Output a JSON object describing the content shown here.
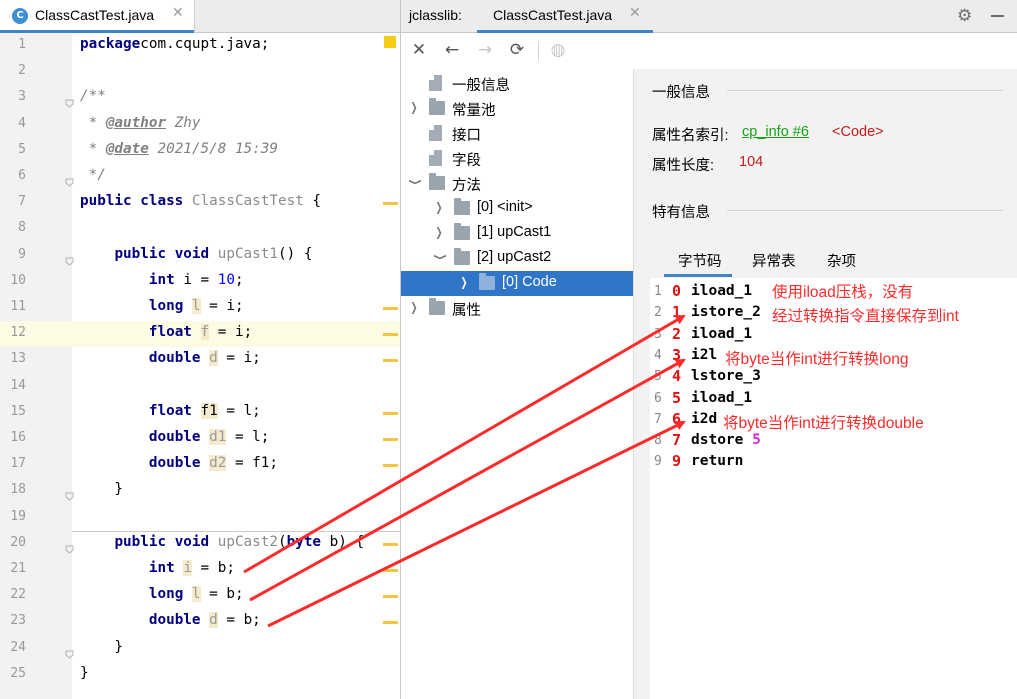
{
  "editor": {
    "tab": {
      "icon_letter": "C",
      "label": "ClassCastTest.java",
      "close": "✕"
    },
    "lines": [
      {
        "n": "1",
        "tokens": [
          [
            "kw",
            "package"
          ],
          [
            "",
            "com.cqupt.java;"
          ]
        ]
      },
      {
        "n": "2",
        "tokens": []
      },
      {
        "n": "3",
        "tokens": [
          [
            "cm",
            "/**"
          ]
        ]
      },
      {
        "n": "4",
        "tokens": [
          [
            "cm",
            " * "
          ],
          [
            "tag",
            "@author"
          ],
          [
            "cm",
            " Zhy"
          ]
        ]
      },
      {
        "n": "5",
        "tokens": [
          [
            "cm",
            " * "
          ],
          [
            "tag",
            "@date"
          ],
          [
            "cm",
            " 2021/5/8 15:39"
          ]
        ]
      },
      {
        "n": "6",
        "tokens": [
          [
            "cm",
            " */"
          ]
        ]
      },
      {
        "n": "7",
        "tokens": [
          [
            "kw",
            "public class "
          ],
          [
            "grey",
            "ClassCastTest"
          ],
          [
            "",
            " {"
          ]
        ]
      },
      {
        "n": "8",
        "tokens": []
      },
      {
        "n": "9",
        "tokens": [
          [
            "",
            "    "
          ],
          [
            "kw",
            "public void "
          ],
          [
            "grey",
            "upCast1"
          ],
          [
            "",
            "() {"
          ]
        ]
      },
      {
        "n": "10",
        "tokens": [
          [
            "",
            "        "
          ],
          [
            "kw",
            "int "
          ],
          [
            "",
            "i = "
          ],
          [
            "num",
            "10"
          ],
          [
            "",
            ";"
          ]
        ]
      },
      {
        "n": "11",
        "tokens": [
          [
            "",
            "        "
          ],
          [
            "kw",
            "long "
          ],
          [
            "unused",
            "l"
          ],
          [
            "",
            " = i;"
          ]
        ]
      },
      {
        "n": "12",
        "tokens": [
          [
            "",
            "        "
          ],
          [
            "kw",
            "float "
          ],
          [
            "unused",
            "f"
          ],
          [
            "",
            " = i;"
          ]
        ]
      },
      {
        "n": "13",
        "tokens": [
          [
            "",
            "        "
          ],
          [
            "kw",
            "double "
          ],
          [
            "unused",
            "d"
          ],
          [
            "",
            " = i;"
          ]
        ]
      },
      {
        "n": "14",
        "tokens": []
      },
      {
        "n": "15",
        "tokens": [
          [
            "",
            "        "
          ],
          [
            "kw",
            "float "
          ],
          [
            "vhl",
            "f1"
          ],
          [
            "",
            " = l;"
          ]
        ]
      },
      {
        "n": "16",
        "tokens": [
          [
            "",
            "        "
          ],
          [
            "kw",
            "double "
          ],
          [
            "unused",
            "d1"
          ],
          [
            "",
            " = l;"
          ]
        ]
      },
      {
        "n": "17",
        "tokens": [
          [
            "",
            "        "
          ],
          [
            "kw",
            "double "
          ],
          [
            "unused",
            "d2"
          ],
          [
            "",
            " = f1;"
          ]
        ]
      },
      {
        "n": "18",
        "tokens": [
          [
            "",
            "    }"
          ]
        ]
      },
      {
        "n": "19",
        "tokens": []
      },
      {
        "n": "20",
        "tokens": [
          [
            "",
            "    "
          ],
          [
            "kw",
            "public void "
          ],
          [
            "grey",
            "upCast2"
          ],
          [
            "",
            "("
          ],
          [
            "kw",
            "byte "
          ],
          [
            "",
            "b) {"
          ]
        ]
      },
      {
        "n": "21",
        "tokens": [
          [
            "",
            "        "
          ],
          [
            "kw",
            "int "
          ],
          [
            "unused",
            "i"
          ],
          [
            "",
            " = b;"
          ]
        ]
      },
      {
        "n": "22",
        "tokens": [
          [
            "",
            "        "
          ],
          [
            "kw",
            "long "
          ],
          [
            "unused",
            "l"
          ],
          [
            "",
            " = b;"
          ]
        ]
      },
      {
        "n": "23",
        "tokens": [
          [
            "",
            "        "
          ],
          [
            "kw",
            "double "
          ],
          [
            "unused",
            "d"
          ],
          [
            "",
            " = b;"
          ]
        ]
      },
      {
        "n": "24",
        "tokens": [
          [
            "",
            "    }"
          ]
        ]
      },
      {
        "n": "25",
        "tokens": [
          [
            "",
            "}"
          ]
        ]
      }
    ]
  },
  "jclasslib": {
    "title": "jclasslib:",
    "tab_label": "ClassCastTest.java",
    "tab_close": "✕",
    "toolbar": {
      "close": "✕",
      "back": "←",
      "forward": "→",
      "refresh": "⟳",
      "web": "◍"
    },
    "tree": [
      {
        "label": "一般信息",
        "indent": 0,
        "arrow": "",
        "icon": "page",
        "selected": false
      },
      {
        "label": "常量池",
        "indent": 0,
        "arrow": "›",
        "icon": "folder",
        "selected": false
      },
      {
        "label": "接口",
        "indent": 0,
        "arrow": "",
        "icon": "page",
        "selected": false
      },
      {
        "label": "字段",
        "indent": 0,
        "arrow": "",
        "icon": "page",
        "selected": false
      },
      {
        "label": "方法",
        "indent": 0,
        "arrow": "⌄",
        "icon": "folder",
        "selected": false
      },
      {
        "label": "[0] <init>",
        "indent": 1,
        "arrow": "›",
        "icon": "folder",
        "selected": false
      },
      {
        "label": "[1] upCast1",
        "indent": 1,
        "arrow": "›",
        "icon": "folder",
        "selected": false
      },
      {
        "label": "[2] upCast2",
        "indent": 1,
        "arrow": "⌄",
        "icon": "folder",
        "selected": false
      },
      {
        "label": "[0] Code",
        "indent": 2,
        "arrow": "›",
        "icon": "folder",
        "selected": true
      },
      {
        "label": "属性",
        "indent": 0,
        "arrow": "›",
        "icon": "folder",
        "selected": false
      }
    ],
    "detail": {
      "general_title": "一般信息",
      "attr_name_label": "属性名索引:",
      "attr_name_link": "cp_info #6",
      "attr_name_value": "<Code>",
      "attr_len_label": "属性长度:",
      "attr_len_value": "104",
      "specific_title": "特有信息",
      "subtabs": [
        "字节码",
        "异常表",
        "杂项"
      ],
      "bytecode": [
        {
          "n": "1",
          "off": "0",
          "op": "iload_1",
          "arg": ""
        },
        {
          "n": "2",
          "off": "1",
          "op": "istore_2",
          "arg": ""
        },
        {
          "n": "3",
          "off": "2",
          "op": "iload_1",
          "arg": ""
        },
        {
          "n": "4",
          "off": "3",
          "op": "i2l",
          "arg": ""
        },
        {
          "n": "5",
          "off": "4",
          "op": "lstore_3",
          "arg": ""
        },
        {
          "n": "6",
          "off": "5",
          "op": "iload_1",
          "arg": ""
        },
        {
          "n": "7",
          "off": "6",
          "op": "i2d",
          "arg": ""
        },
        {
          "n": "8",
          "off": "7",
          "op": "dstore",
          "arg": "5"
        },
        {
          "n": "9",
          "off": "9",
          "op": "return",
          "arg": ""
        }
      ]
    }
  },
  "annotations": {
    "a1": "使用iload压栈，没有",
    "a2": "经过转换指令直接保存到int",
    "a3": "将byte当作int进行转换long",
    "a4": "将byte当作int进行转换double",
    "arrow_color": "#ff2b2b"
  }
}
